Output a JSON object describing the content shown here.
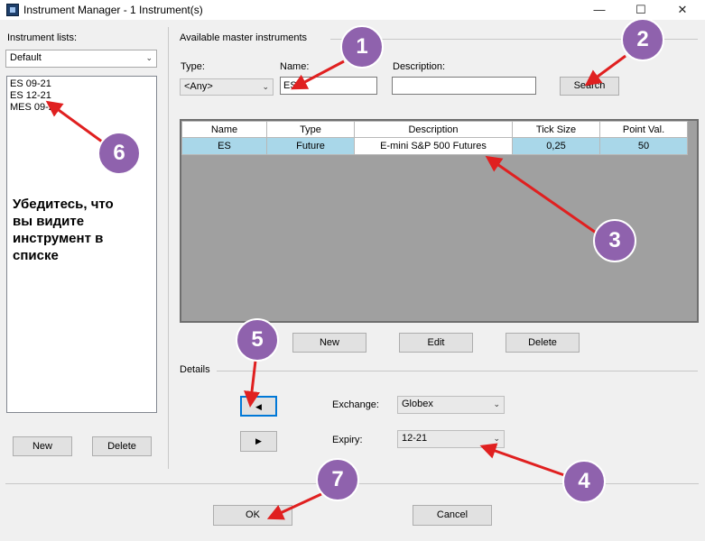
{
  "window": {
    "title": "Instrument Manager - 1 Instrument(s)",
    "min": "—",
    "max": "☐",
    "close": "✕"
  },
  "left": {
    "lists_label": "Instrument lists:",
    "list_value": "Default",
    "items": [
      "ES 09-21",
      "ES 12-21",
      "MES 09-21"
    ],
    "new_label": "New",
    "delete_label": "Delete"
  },
  "master": {
    "group_label": "Available master instruments",
    "type_label": "Type:",
    "type_value": "<Any>",
    "name_label": "Name:",
    "name_value": "ES",
    "desc_label": "Description:",
    "desc_value": "",
    "search_label": "Search",
    "columns": [
      "Name",
      "Type",
      "Description",
      "Tick Size",
      "Point Val."
    ],
    "rows": [
      [
        "ES",
        "Future",
        "E-mini S&P 500 Futures",
        "0,25",
        "50"
      ]
    ],
    "new_label": "New",
    "edit_label": "Edit",
    "delete_label": "Delete"
  },
  "details": {
    "label": "Details",
    "prev_arrow": "◀",
    "next_arrow": "▶",
    "exchange_label": "Exchange:",
    "exchange_value": "Globex",
    "expiry_label": "Expiry:",
    "expiry_value": "12-21"
  },
  "footer": {
    "ok_label": "OK",
    "cancel_label": "Cancel"
  },
  "annotations": {
    "badges": [
      "1",
      "2",
      "3",
      "4",
      "5",
      "6",
      "7"
    ],
    "note": [
      "Убедитесь, что",
      "вы видите",
      "инструмент в",
      "списке"
    ],
    "badge_color": "#8f62ad",
    "arrow_color": "#e02020"
  }
}
